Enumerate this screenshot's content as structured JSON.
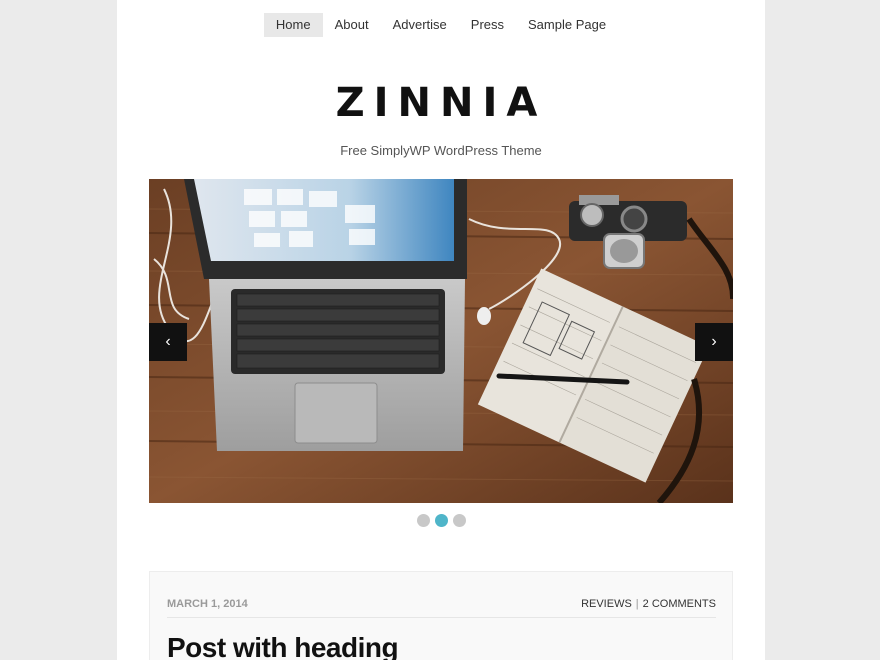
{
  "nav": {
    "items": [
      {
        "label": "Home",
        "active": true
      },
      {
        "label": "About",
        "active": false
      },
      {
        "label": "Advertise",
        "active": false
      },
      {
        "label": "Press",
        "active": false
      },
      {
        "label": "Sample Page",
        "active": false
      }
    ]
  },
  "header": {
    "title": "ZINNIA",
    "tagline": "Free SimplyWP WordPress Theme"
  },
  "slider": {
    "prev_icon": "chevron-left-icon",
    "next_icon": "chevron-right-icon",
    "prev_glyph": "‹",
    "next_glyph": "›",
    "slide_count": 3,
    "active_index": 1,
    "active_color": "#4fb5c9"
  },
  "post": {
    "date": "MARCH 1, 2014",
    "category": "REVIEWS",
    "separator": "|",
    "comments": "2 COMMENTS",
    "title": "Post with heading"
  }
}
